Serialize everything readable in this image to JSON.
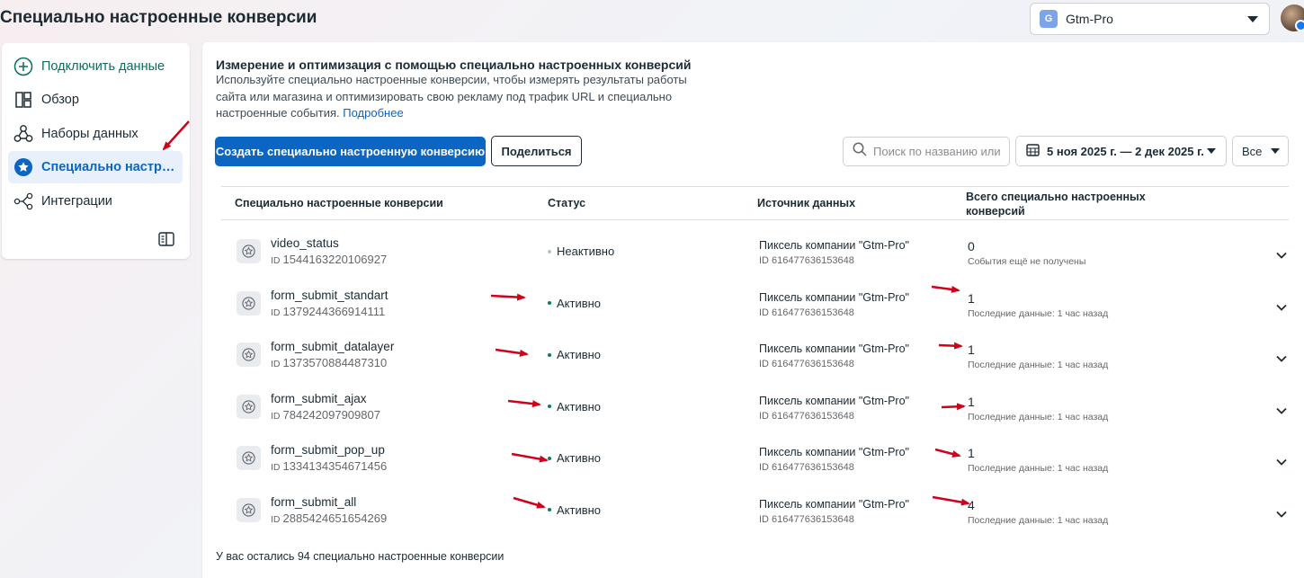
{
  "page": {
    "title": "Специально настроенные конверсии"
  },
  "account": {
    "badge_letter": "G",
    "name": "Gtm-Pro"
  },
  "sidebar": {
    "items": [
      {
        "icon": "plus-circle-icon",
        "label": "Подключить данные"
      },
      {
        "icon": "overview-icon",
        "label": "Обзор"
      },
      {
        "icon": "datasets-icon",
        "label": "Наборы данных"
      },
      {
        "icon": "star-badge-icon",
        "label": "Специально настроенные конверсии"
      },
      {
        "icon": "integrations-icon",
        "label": "Интеграции"
      }
    ],
    "active_index": 3
  },
  "intro": {
    "title": "Измерение и оптимизация с помощью специально настроенных конверсий",
    "text": "Используйте специально настроенные конверсии, чтобы измерять результаты работы сайта или магазина и оптимизировать свою рекламу под трафик URL и специально настроенные события.",
    "learn_more": "Подробнее"
  },
  "toolbar": {
    "create_label": "Создать специально настроенную конверсию",
    "share_label": "Поделиться",
    "search_placeholder": "Поиск по названию или",
    "date_range": "5 ноя 2025 г. — 2 дек 2025 г.",
    "filter_value": "Все"
  },
  "table": {
    "headers": {
      "name": "Специально настроенные конверсии",
      "status": "Статус",
      "source": "Источник данных",
      "total": "Всего специально настроенных конверсий"
    },
    "id_prefix": "ID",
    "rows": [
      {
        "name": "video_status",
        "id": "1544163220106927",
        "status": "Неактивно",
        "status_color": "#bcc0c4",
        "source": "Пиксель компании \"Gtm-Pro\"",
        "source_id": "ID 616477636153648",
        "total": "0",
        "note": "События ещё не получены"
      },
      {
        "name": "form_submit_standart",
        "id": "1379244366914111",
        "status": "Активно",
        "status_color": "#0a7c5c",
        "source": "Пиксель компании \"Gtm-Pro\"",
        "source_id": "ID 616477636153648",
        "total": "1",
        "note": "Последние данные: 1 час назад"
      },
      {
        "name": "form_submit_datalayer",
        "id": "1373570884487310",
        "status": "Активно",
        "status_color": "#0a7c5c",
        "source": "Пиксель компании \"Gtm-Pro\"",
        "source_id": "ID 616477636153648",
        "total": "1",
        "note": "Последние данные: 1 час назад"
      },
      {
        "name": "form_submit_ajax",
        "id": "784242097909807",
        "status": "Активно",
        "status_color": "#0a7c5c",
        "source": "Пиксель компании \"Gtm-Pro\"",
        "source_id": "ID 616477636153648",
        "total": "1",
        "note": "Последние данные: 1 час назад"
      },
      {
        "name": "form_submit_pop_up",
        "id": "1334134354671456",
        "status": "Активно",
        "status_color": "#0a7c5c",
        "source": "Пиксель компании \"Gtm-Pro\"",
        "source_id": "ID 616477636153648",
        "total": "1",
        "note": "Последние данные: 1 час назад"
      },
      {
        "name": "form_submit_all",
        "id": "2885424651654269",
        "status": "Активно",
        "status_color": "#0a7c5c",
        "source": "Пиксель компании \"Gtm-Pro\"",
        "source_id": "ID 616477636153648",
        "total": "4",
        "note": "Последние данные: 1 час назад"
      }
    ]
  },
  "footer": {
    "remaining": "У вас остались 94 специально настроенные конверсии"
  },
  "colors": {
    "accent": "#0a66c2",
    "active_status": "#0a7c5c",
    "annotation_arrow": "#d0021b"
  }
}
